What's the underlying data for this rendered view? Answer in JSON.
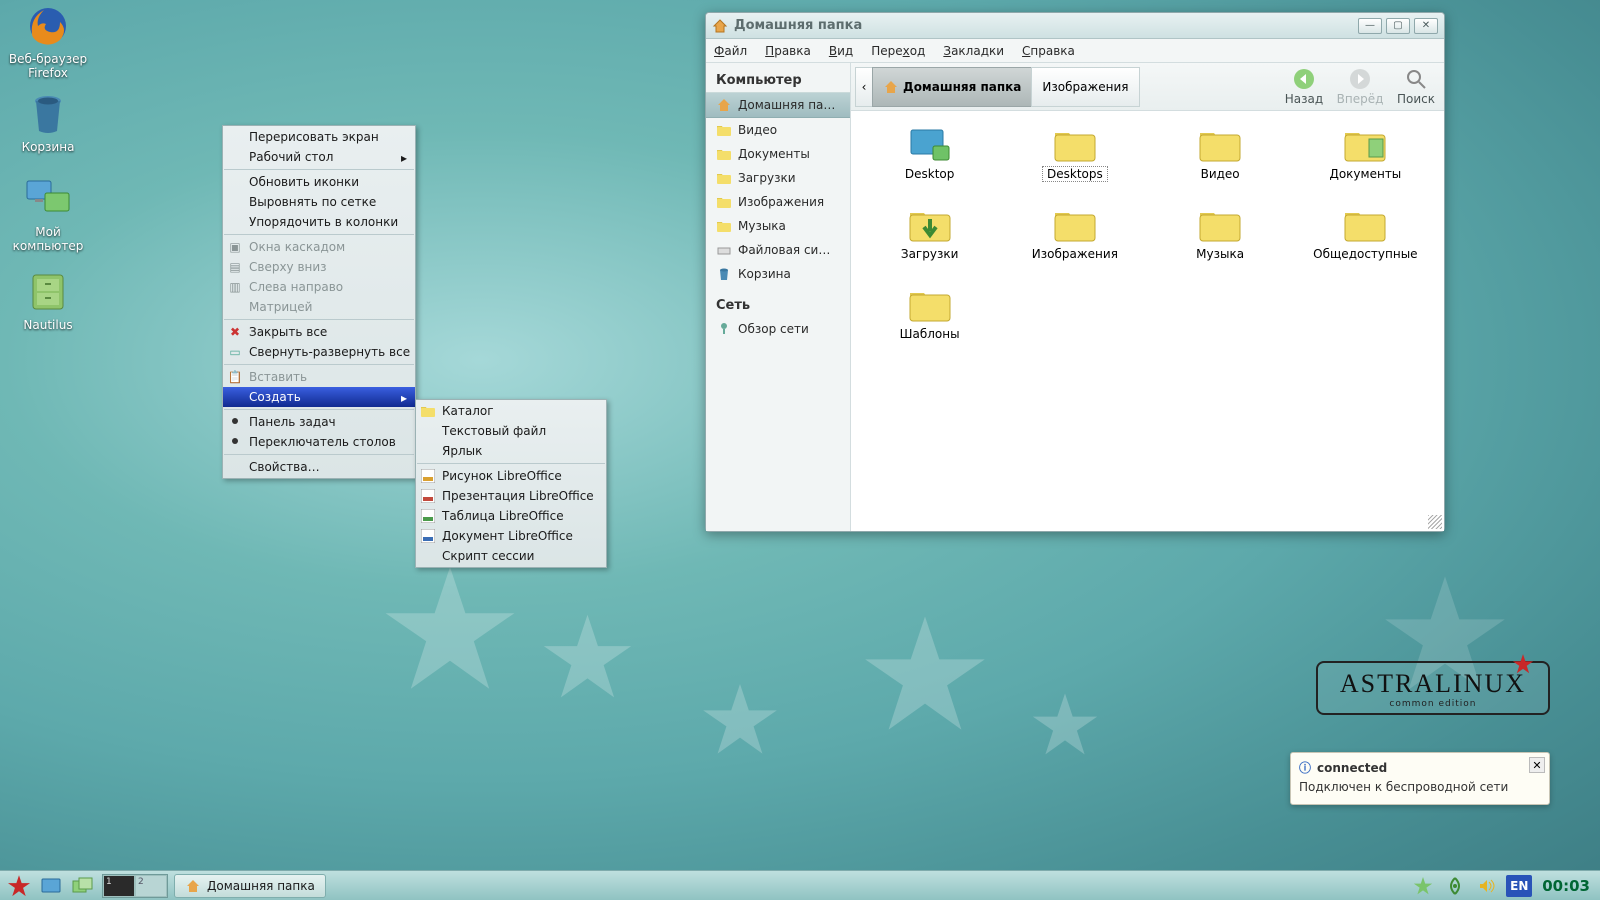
{
  "desktop_icons": {
    "firefox": {
      "l1": "Веб-браузер",
      "l2": "Firefox"
    },
    "trash": {
      "l1": "Корзина"
    },
    "computer": {
      "l1": "Мой",
      "l2": "компьютер"
    },
    "nautilus": {
      "l1": "Nautilus"
    }
  },
  "context_menu": {
    "redraw": "Перерисовать экран",
    "desktop": "Рабочий стол",
    "refresh_icons": "Обновить иконки",
    "align_grid": "Выровнять по сетке",
    "sort_columns": "Упорядочить в колонки",
    "cascade": "Окна каскадом",
    "top_down": "Сверху вниз",
    "left_right": "Слева направо",
    "matrix": "Матрицей",
    "close_all": "Закрыть все",
    "toggle_all": "Свернуть-развернуть все",
    "paste": "Вставить",
    "create": "Создать",
    "taskbar": "Панель задач",
    "pager": "Переключатель столов",
    "properties": "Свойства…"
  },
  "create_submenu": {
    "folder": "Каталог",
    "textfile": "Текстовый файл",
    "link": "Ярлык",
    "lo_draw": "Рисунок LibreOffice",
    "lo_impress": "Презентация LibreOffice",
    "lo_calc": "Таблица LibreOffice",
    "lo_writer": "Документ LibreOffice",
    "session": "Скрипт сессии"
  },
  "window": {
    "title": "Домашняя папка",
    "menus": {
      "file": "Файл",
      "edit": "Правка",
      "view": "Вид",
      "go": "Переход",
      "bookmarks": "Закладки",
      "help": "Справка"
    },
    "tools": {
      "back": "Назад",
      "forward": "Вперёд",
      "search": "Поиск"
    },
    "breadcrumbs": {
      "home": "Домашняя папка",
      "images": "Изображения"
    },
    "sidebar": {
      "hdr_computer": "Компьютер",
      "home": "Домашняя па…",
      "video": "Видео",
      "documents": "Документы",
      "downloads": "Загрузки",
      "images": "Изображения",
      "music": "Музыка",
      "fs": "Файловая си…",
      "trash": "Корзина",
      "hdr_network": "Сеть",
      "netview": "Обзор сети"
    },
    "files": {
      "desktop": "Desktop",
      "desktops": "Desktops",
      "video": "Видео",
      "documents": "Документы",
      "downloads": "Загрузки",
      "images": "Изображения",
      "music": "Музыка",
      "public": "Общедоступные",
      "templates": "Шаблоны"
    }
  },
  "brand": {
    "name": "ASTRALINUX",
    "edition": "common edition"
  },
  "notification": {
    "title": "connected",
    "body": "Подключен к беспроводной сети"
  },
  "taskbar": {
    "window": "Домашняя папка",
    "lang": "EN",
    "clock": "00:03",
    "pager": {
      "d1": "1",
      "d2": "2"
    }
  }
}
